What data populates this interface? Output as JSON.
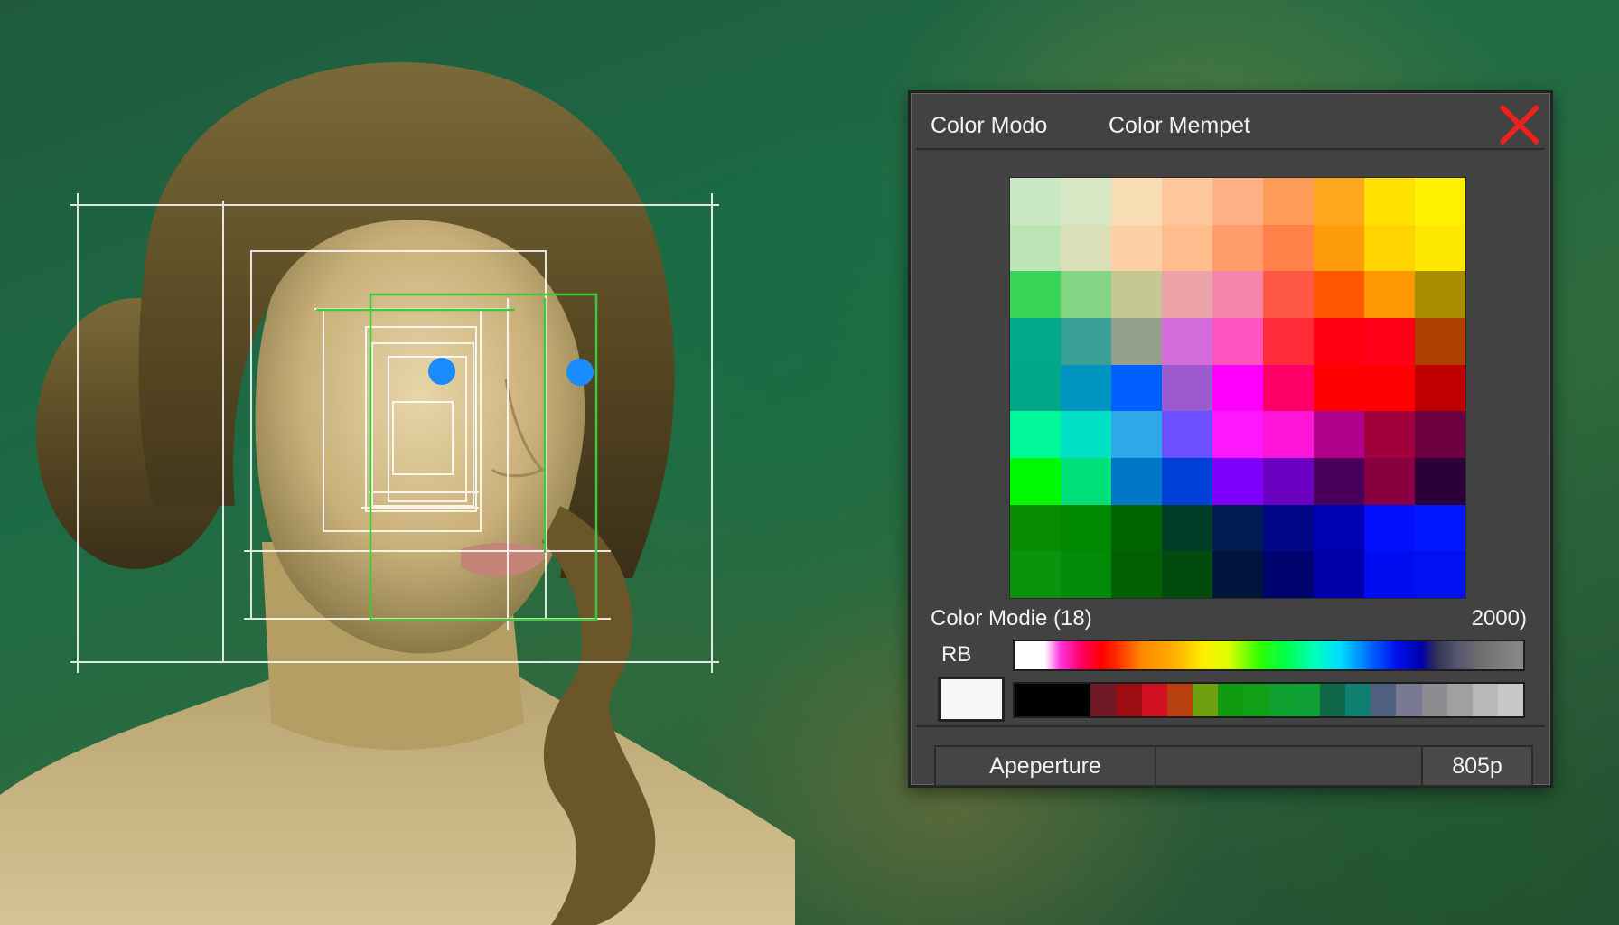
{
  "panel": {
    "tabs": [
      "Color Modo",
      "Color Mempet"
    ],
    "close_icon": "close-icon",
    "close_color": "#e8231f",
    "palette": [
      [
        "#c8e8c4",
        "#d8e8c4",
        "#f8dcb4",
        "#ffc89c",
        "#ffb084",
        "#ff9c58",
        "#ffa81c",
        "#ffe000",
        "#fff200"
      ],
      [
        "#bce4b4",
        "#dce0b8",
        "#fcd0a4",
        "#ffbc8c",
        "#ff9c6c",
        "#ff8048",
        "#ff9c0c",
        "#ffd400",
        "#ffe800"
      ],
      [
        "#38d458",
        "#84d484",
        "#c4c894",
        "#eca4a8",
        "#f484ac",
        "#ff5844",
        "#ff5800",
        "#ff9800",
        "#a88c00"
      ],
      [
        "#00a88c",
        "#38a094",
        "#94a08c",
        "#d46cdc",
        "#ff54c0",
        "#ff2c38",
        "#ff0010",
        "#ff0018",
        "#b04000"
      ],
      [
        "#00a888",
        "#0094c0",
        "#0060ff",
        "#9c5cd0",
        "#ff00ff",
        "#ff0068",
        "#ff0000",
        "#ff0000",
        "#c00000"
      ],
      [
        "#00f898",
        "#00e0c4",
        "#30a8e8",
        "#6c50ff",
        "#ff18ff",
        "#ff14d8",
        "#b0008c",
        "#a0003c",
        "#6c0040"
      ],
      [
        "#00f800",
        "#00e078",
        "#0078c8",
        "#0040d8",
        "#8000ff",
        "#6c00c0",
        "#48005c",
        "#880040",
        "#2c0038"
      ],
      [
        "#088c00",
        "#008800",
        "#006400",
        "#003c28",
        "#001c50",
        "#000888",
        "#0000b4",
        "#0010ff",
        "#0018ff"
      ],
      [
        "#08940c",
        "#008c08",
        "#006000",
        "#004c0c",
        "#00143c",
        "#000470",
        "#0000a8",
        "#000cf0",
        "#0010f0"
      ]
    ],
    "color_mode_label": "Color Modie (18)",
    "color_mode_value": "2000)",
    "rb_label": "RB",
    "strip_colors": [
      "#000000",
      "#000000",
      "#000000",
      "#701824",
      "#9c0c10",
      "#d01020",
      "#b84010",
      "#70a010",
      "#109c10",
      "#10a018",
      "#10a030",
      "#10a038",
      "#106848",
      "#108070",
      "#506080",
      "#787890",
      "#8c8c90",
      "#a0a0a0",
      "#b8b8b8",
      "#c8c8c8"
    ],
    "footer": {
      "label": "Apeperture",
      "value": "805p"
    }
  },
  "overlay_colors": {
    "guide_white": "#ffffff",
    "guide_green": "#3fc83a",
    "eye_blue": "#1a8cff"
  }
}
